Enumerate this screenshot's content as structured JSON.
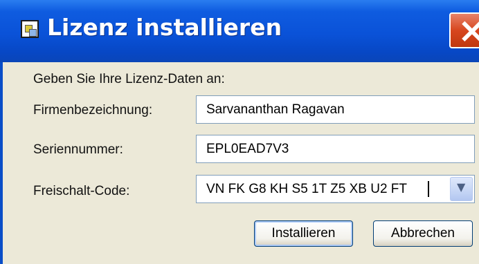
{
  "window": {
    "title": "Lizenz installieren"
  },
  "form": {
    "intro": "Geben Sie Ihre Lizenz-Daten an:",
    "company": {
      "label": "Firmenbezeichnung:",
      "value": "Sarvananthan Ragavan"
    },
    "serial": {
      "label": "Seriennummer:",
      "value": "EPL0EAD7V3"
    },
    "code": {
      "label": "Freischalt-Code:",
      "value": "VN FK G8 KH S5 1T Z5 XB U2 FT"
    }
  },
  "buttons": {
    "install": "Installieren",
    "cancel": "Abbrechen"
  },
  "icons": {
    "title": "license-icon",
    "close": "close-icon",
    "dropdown": "chevron-down-icon"
  },
  "colors": {
    "titlebar": "#0a52d8",
    "close": "#d7461e",
    "dialog_bg": "#ece9d8"
  }
}
